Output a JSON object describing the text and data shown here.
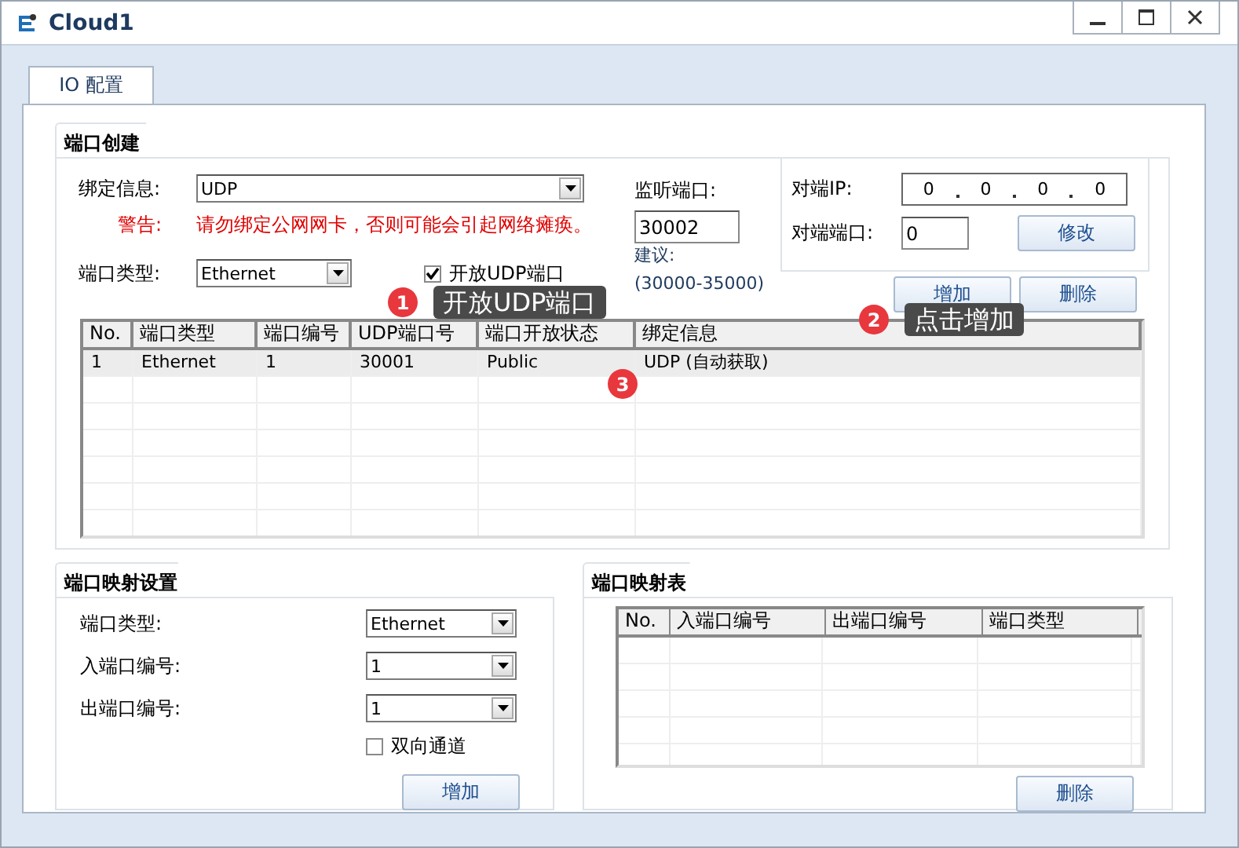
{
  "window": {
    "title": "Cloud1"
  },
  "tabs": [
    {
      "label": "IO 配置",
      "selected": true
    }
  ],
  "port_creation": {
    "title": "端口创建",
    "binding": {
      "label": "绑定信息:",
      "value": "UDP"
    },
    "warning": {
      "label": "警告:",
      "text": "请勿绑定公网网卡，否则可能会引起网络瘫痪。"
    },
    "port_type": {
      "label": "端口类型:",
      "value": "Ethernet"
    },
    "open_udp": {
      "label": "开放UDP端口",
      "checked": true
    },
    "listen_port": {
      "label": "监听端口:",
      "value": "30002",
      "hint_label": "建议:",
      "hint_range": "(30000-35000)"
    },
    "peer": {
      "ip_label": "对端IP:",
      "ip": [
        "0",
        "0",
        "0",
        "0"
      ],
      "port_label": "对端端口:",
      "port": "0",
      "modify_button": "修改"
    },
    "buttons": [
      "增加",
      "删除"
    ],
    "table": {
      "columns": [
        "No.",
        "端口类型",
        "端口编号",
        "UDP端口号",
        "端口开放状态",
        "绑定信息"
      ],
      "rows": [
        {
          "cells": [
            "1",
            "Ethernet",
            "1",
            "30001",
            "Public",
            "UDP (自动获取)"
          ],
          "selected": true
        }
      ]
    }
  },
  "mapping_settings": {
    "title": "端口映射设置",
    "fields": [
      {
        "label": "端口类型:",
        "value": "Ethernet"
      },
      {
        "label": "入端口编号:",
        "value": "1"
      },
      {
        "label": "出端口编号:",
        "value": "1"
      }
    ],
    "bidirectional": {
      "label": "双向通道",
      "checked": false
    },
    "button": "增加"
  },
  "mapping_table": {
    "title": "端口映射表",
    "columns": [
      "No.",
      "入端口编号",
      "出端口编号",
      "端口类型"
    ],
    "button": "删除"
  },
  "annotations": [
    {
      "number": "1",
      "text": "开放UDP端口"
    },
    {
      "number": "2",
      "text": "点击增加"
    },
    {
      "number": "3"
    }
  ]
}
